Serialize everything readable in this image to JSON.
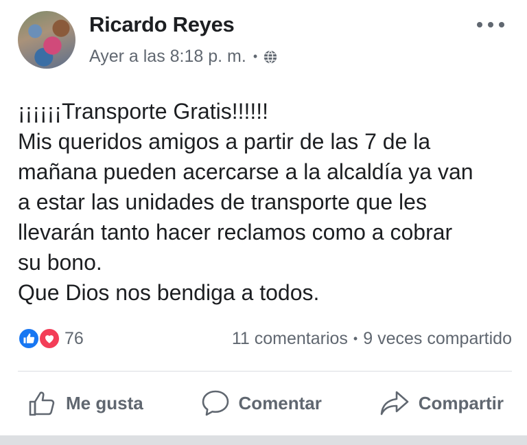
{
  "post": {
    "author": "Ricardo Reyes",
    "timestamp": "Ayer a las 8:18 p. m.",
    "separator": "•",
    "privacy_icon": "globe-icon",
    "more_icon": "more-options-icon",
    "body_lines": [
      "¡¡¡¡¡¡Transporte Gratis!!!!!!",
      "Mis queridos amigos a partir de las 7 de la",
      "mañana pueden acercarse a la alcaldía ya van",
      "a estar las unidades de transporte que les",
      "llevarán tanto hacer reclamos como a cobrar",
      "su bono.",
      "Que Dios nos bendiga a todos."
    ]
  },
  "stats": {
    "reaction_icons": [
      "like-reaction-icon",
      "love-reaction-icon"
    ],
    "reaction_count": "76",
    "comments": "11 comentarios",
    "separator": "•",
    "shares": "9 veces compartido"
  },
  "actions": {
    "like_label": "Me gusta",
    "comment_label": "Comentar",
    "share_label": "Compartir"
  },
  "colors": {
    "text": "#1c1e21",
    "secondary": "#606770",
    "like_blue": "#1877f2",
    "love_red": "#f33e58",
    "divider": "#dadde1"
  }
}
